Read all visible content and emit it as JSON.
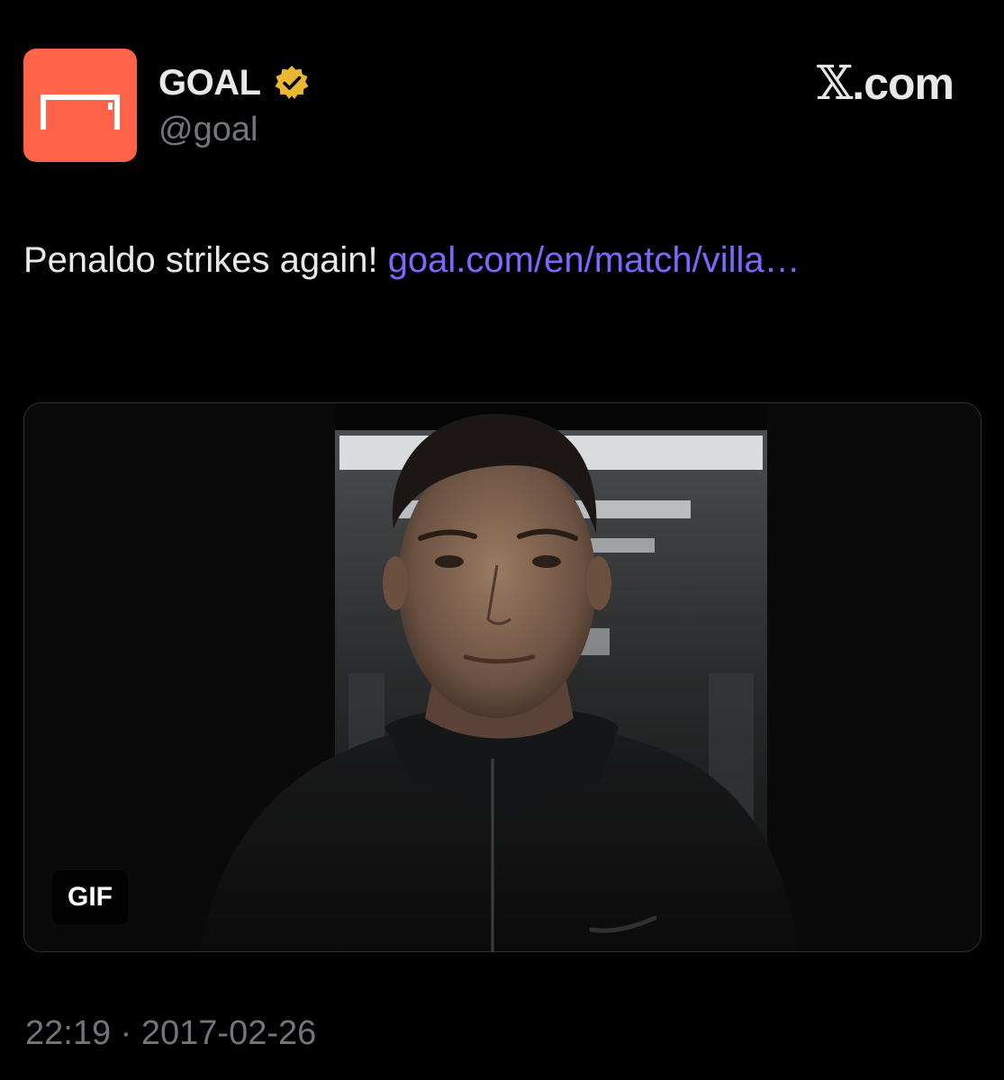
{
  "author": {
    "display_name": "GOAL",
    "handle": "@goal",
    "verified": true,
    "avatar_color": "#ff6448",
    "badge_color": "#e8b830"
  },
  "brand": {
    "x_letter": "𝕏",
    "suffix": ".com"
  },
  "tweet": {
    "text": "Penaldo strikes again! ",
    "link_text": "goal.com/en/match/villa…",
    "link_color": "#7b68ff"
  },
  "media": {
    "badge": "GIF",
    "icon": "gif-media",
    "alt": ""
  },
  "meta": {
    "time": "22:19",
    "separator": " · ",
    "date": "2017-02-26"
  }
}
